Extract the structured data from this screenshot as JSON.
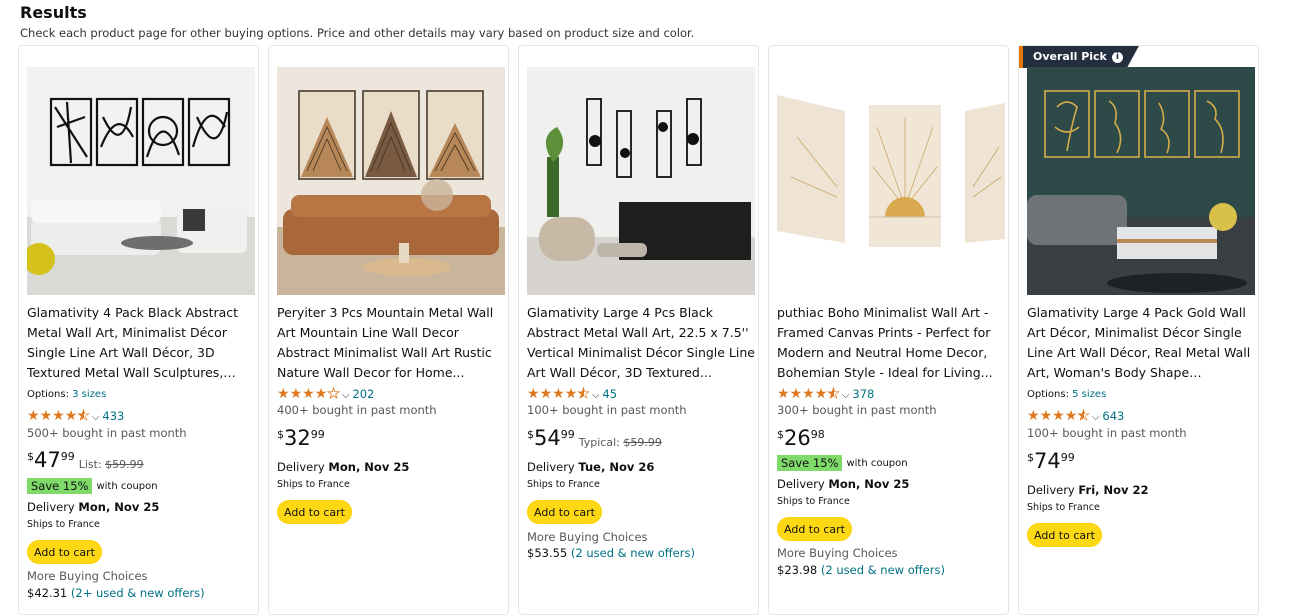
{
  "header": {
    "title": "Results",
    "subtitle": "Check each product page for other buying options. Price and other details may vary based on product size and color."
  },
  "products": [
    {
      "title": "Glamativity 4 Pack Black Abstract Metal Wall Art, Minimalist Décor Single Line Art Wall Décor, 3D Textured Metal Wall Sculptures, for...",
      "options_label": "Options:",
      "options_value": "3 sizes",
      "rating": 4.5,
      "rating_count": "433",
      "bought": "500+ bought in past month",
      "price_symbol": "$",
      "price_whole": "47",
      "price_fraction": "99",
      "list_label": "List:",
      "list_price": "$59.99",
      "coupon_save": "Save 15%",
      "coupon_text": "with coupon",
      "delivery_label": "Delivery",
      "delivery_date": "Mon, Nov 25",
      "ships": "Ships to France",
      "add_to_cart": "Add to cart",
      "more_choices": "More Buying Choices",
      "more_price": "$42.31",
      "more_offers": "(2+ used & new offers)"
    },
    {
      "title": "Peryiter 3 Pcs Mountain Metal Wall Art Mountain Line Wall Decor Abstract Minimalist Wall Art Rustic Nature Wall Decor for Home...",
      "rating": 4.0,
      "rating_count": "202",
      "bought": "400+ bought in past month",
      "price_symbol": "$",
      "price_whole": "32",
      "price_fraction": "99",
      "delivery_label": "Delivery",
      "delivery_date": "Mon, Nov 25",
      "ships": "Ships to France",
      "add_to_cart": "Add to cart"
    },
    {
      "title": "Glamativity Large 4 Pcs Black Abstract Metal Wall Art, 22.5 x 7.5'' Vertical Minimalist Décor Single Line Art Wall Décor, 3D Textured...",
      "rating": 4.5,
      "rating_count": "45",
      "bought": "100+ bought in past month",
      "price_symbol": "$",
      "price_whole": "54",
      "price_fraction": "99",
      "list_label": "Typical:",
      "list_price": "$59.99",
      "delivery_label": "Delivery",
      "delivery_date": "Tue, Nov 26",
      "ships": "Ships to France",
      "add_to_cart": "Add to cart",
      "more_choices": "More Buying Choices",
      "more_price": "$53.55",
      "more_offers": "(2 used & new offers)"
    },
    {
      "title": "puthiac Boho Minimalist Wall Art - Framed Canvas Prints - Perfect for Modern and Neutral Home Decor, Bohemian Style - Ideal for Living...",
      "rating": 4.5,
      "rating_count": "378",
      "bought": "300+ bought in past month",
      "price_symbol": "$",
      "price_whole": "26",
      "price_fraction": "98",
      "coupon_save": "Save 15%",
      "coupon_text": "with coupon",
      "delivery_label": "Delivery",
      "delivery_date": "Mon, Nov 25",
      "ships": "Ships to France",
      "add_to_cart": "Add to cart",
      "more_choices": "More Buying Choices",
      "more_price": "$23.98",
      "more_offers": "(2 used & new offers)"
    },
    {
      "badge": "Overall Pick",
      "title": "Glamativity Large 4 Pack Gold Wall Art Décor, Minimalist Décor Single Line Art Wall Décor, Real Metal Wall Art, Woman's Body Shape Abstract...",
      "options_label": "Options:",
      "options_value": "5 sizes",
      "rating": 4.5,
      "rating_count": "643",
      "bought": "100+ bought in past month",
      "price_symbol": "$",
      "price_whole": "74",
      "price_fraction": "99",
      "delivery_label": "Delivery",
      "delivery_date": "Fri, Nov 22",
      "ships": "Ships to France",
      "add_to_cart": "Add to cart"
    }
  ],
  "colors": {
    "star": "#de7921",
    "link": "#007185",
    "button": "#ffd814",
    "coupon": "#7fda69",
    "badge": "#232f3e"
  }
}
